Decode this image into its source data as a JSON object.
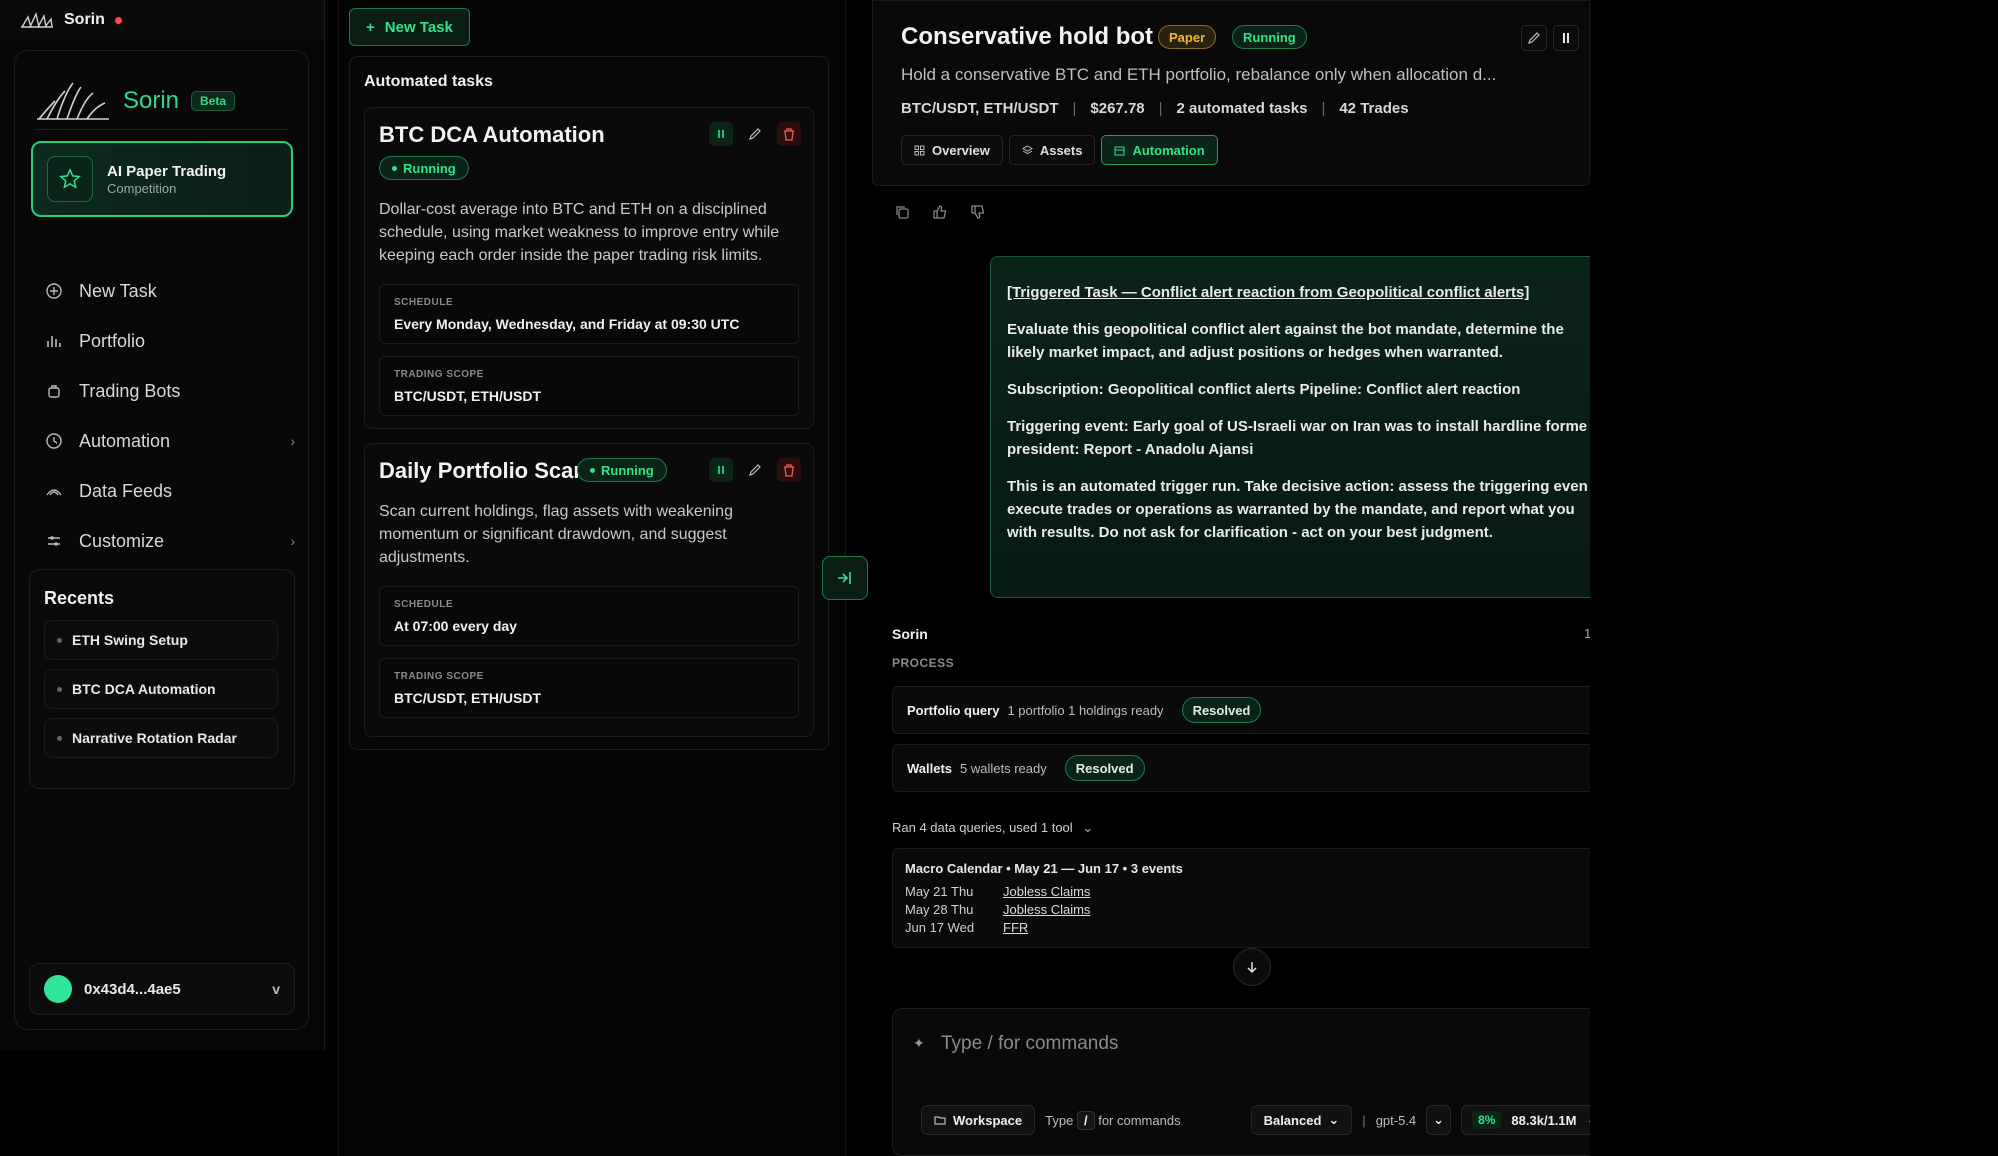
{
  "window": {
    "title": "Sorin"
  },
  "sidebar": {
    "brand": "Sorin",
    "beta": "Beta",
    "promo": {
      "title": "AI Paper Trading",
      "subtitle": "Competition"
    },
    "nav": [
      {
        "label": "New Task",
        "icon": "plus-circle-icon"
      },
      {
        "label": "Portfolio",
        "icon": "bar-chart-icon"
      },
      {
        "label": "Trading Bots",
        "icon": "bot-icon"
      },
      {
        "label": "Automation",
        "icon": "clock-icon",
        "chevron": "›"
      },
      {
        "label": "Data Feeds",
        "icon": "signal-icon"
      },
      {
        "label": "Customize",
        "icon": "sliders-icon",
        "chevron": "›"
      }
    ],
    "recents_title": "Recents",
    "recents": [
      "ETH Swing Setup",
      "BTC DCA Automation",
      "Narrative Rotation Radar"
    ],
    "wallet": {
      "address": "0x43d4...4ae5",
      "caret": "v"
    }
  },
  "tasks_panel": {
    "new_task": "New Task",
    "title": "Automated tasks",
    "tasks": [
      {
        "title": "BTC DCA Automation",
        "status": "Running",
        "description": "Dollar-cost average into BTC and ETH on a disciplined schedule, using market weakness to improve entry while keeping each order inside the paper trading risk limits.",
        "schedule_label": "SCHEDULE",
        "schedule": "Every Monday, Wednesday, and Friday at 09:30 UTC",
        "scope_label": "TRADING SCOPE",
        "scope": "BTC/USDT, ETH/USDT"
      },
      {
        "title": "Daily Portfolio Scan",
        "status": "Running",
        "description": "Scan current holdings, flag assets with weakening momentum or significant drawdown, and suggest adjustments.",
        "schedule_label": "SCHEDULE",
        "schedule": "At 07:00 every day",
        "scope_label": "TRADING SCOPE",
        "scope": "BTC/USDT, ETH/USDT"
      }
    ]
  },
  "bot": {
    "title": "Conservative hold bot",
    "badge_paper": "Paper",
    "badge_running": "Running",
    "description": "Hold a conservative BTC and ETH portfolio, rebalance only when allocation d...",
    "meta": {
      "pairs": "BTC/USDT, ETH/USDT",
      "sep": "|",
      "value": "$267.78",
      "tasks": "2 automated tasks",
      "trades": "42 Trades"
    },
    "tabs": [
      "Overview",
      "Assets",
      "Automation"
    ]
  },
  "message": {
    "link": "[Triggered Task — Conflict alert reaction from Geopolitical conflict alerts]",
    "p1a": "Evaluate this geopolitical conflict alert against the bot mandate, determine the",
    "p1b": "likely market impact, and adjust positions or hedges when warranted.",
    "p2": "Subscription: Geopolitical conflict alerts Pipeline: Conflict alert reaction",
    "p3a": "Triggering event: Early goal of US-Israeli war on Iran was to install hardline forme",
    "p3b": "president: Report - Anadolu Ajansi",
    "p4a": "This is an automated trigger run. Take decisive action: assess the triggering even",
    "p4b": "execute trades or operations as warranted by the mandate, and report what you",
    "p4c": "with results. Do not ask for clarification - act on your best judgment."
  },
  "response": {
    "author": "Sorin",
    "counter": "1",
    "process_label": "PROCESS",
    "rows": [
      {
        "name": "Portfolio query",
        "detail": "1 portfolio 1 holdings ready",
        "status": "Resolved"
      },
      {
        "name": "Wallets",
        "detail": "5 wallets ready",
        "status": "Resolved"
      }
    ],
    "ran_summary": "Ran 4 data queries, used 1 tool",
    "ran_caret": "⌄",
    "macro": {
      "title": "Macro Calendar • May 21 — Jun 17 • 3 events",
      "events": [
        {
          "date": "May 21 Thu",
          "name": "Jobless Claims"
        },
        {
          "date": "May 28 Thu",
          "name": "Jobless Claims"
        },
        {
          "date": "Jun 17 Wed",
          "name": "FFR"
        }
      ]
    }
  },
  "composer": {
    "placeholder": "Type / for commands",
    "workspace": "Workspace",
    "hint_pre": "Type",
    "hint_key": "/",
    "hint_post": "for commands",
    "mode": "Balanced",
    "divider": "|",
    "model": "gpt-5.4",
    "context_pct": "8%",
    "context_tokens": "88.3k/1.1M"
  },
  "colors": {
    "accent": "#34e08d",
    "paper": "#f4b63a",
    "danger": "#ff4b4b",
    "bg": "#000000"
  }
}
